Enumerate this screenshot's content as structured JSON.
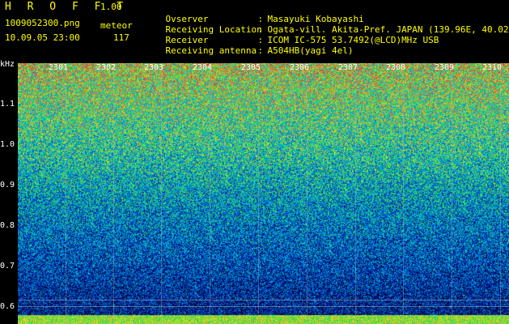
{
  "header": {
    "brand": "H R O F F T",
    "version": "1.00",
    "filename": "1009052300.png",
    "mode": "meteor",
    "datetime": "10.09.05 23:00",
    "count": "117"
  },
  "info": [
    {
      "key": "Ovserver",
      "value": "Masayuki Kobayashi"
    },
    {
      "key": "Receiving Location",
      "value": "Ogata-vill. Akita-Pref. JAPAN (139.96E, 40.02N)"
    },
    {
      "key": "Receiver",
      "value": "ICOM IC-575 53.7492(@LCD)MHz USB"
    },
    {
      "key": "Receiving antenna",
      "value": "A504HB(yagi 4el)"
    }
  ],
  "axis": {
    "unit": "kHz",
    "y_labels": [
      "1.1",
      "1.0",
      "0.9",
      "0.8",
      "0.7",
      "0.6"
    ],
    "x_ticks": [
      "2301",
      "2302",
      "2303",
      "2304",
      "2305",
      "2306",
      "2307",
      "2308",
      "2309",
      "2310"
    ]
  },
  "colors": {
    "text": "#ffff00",
    "axis_text": "#ffffff",
    "background": "#000000"
  }
}
